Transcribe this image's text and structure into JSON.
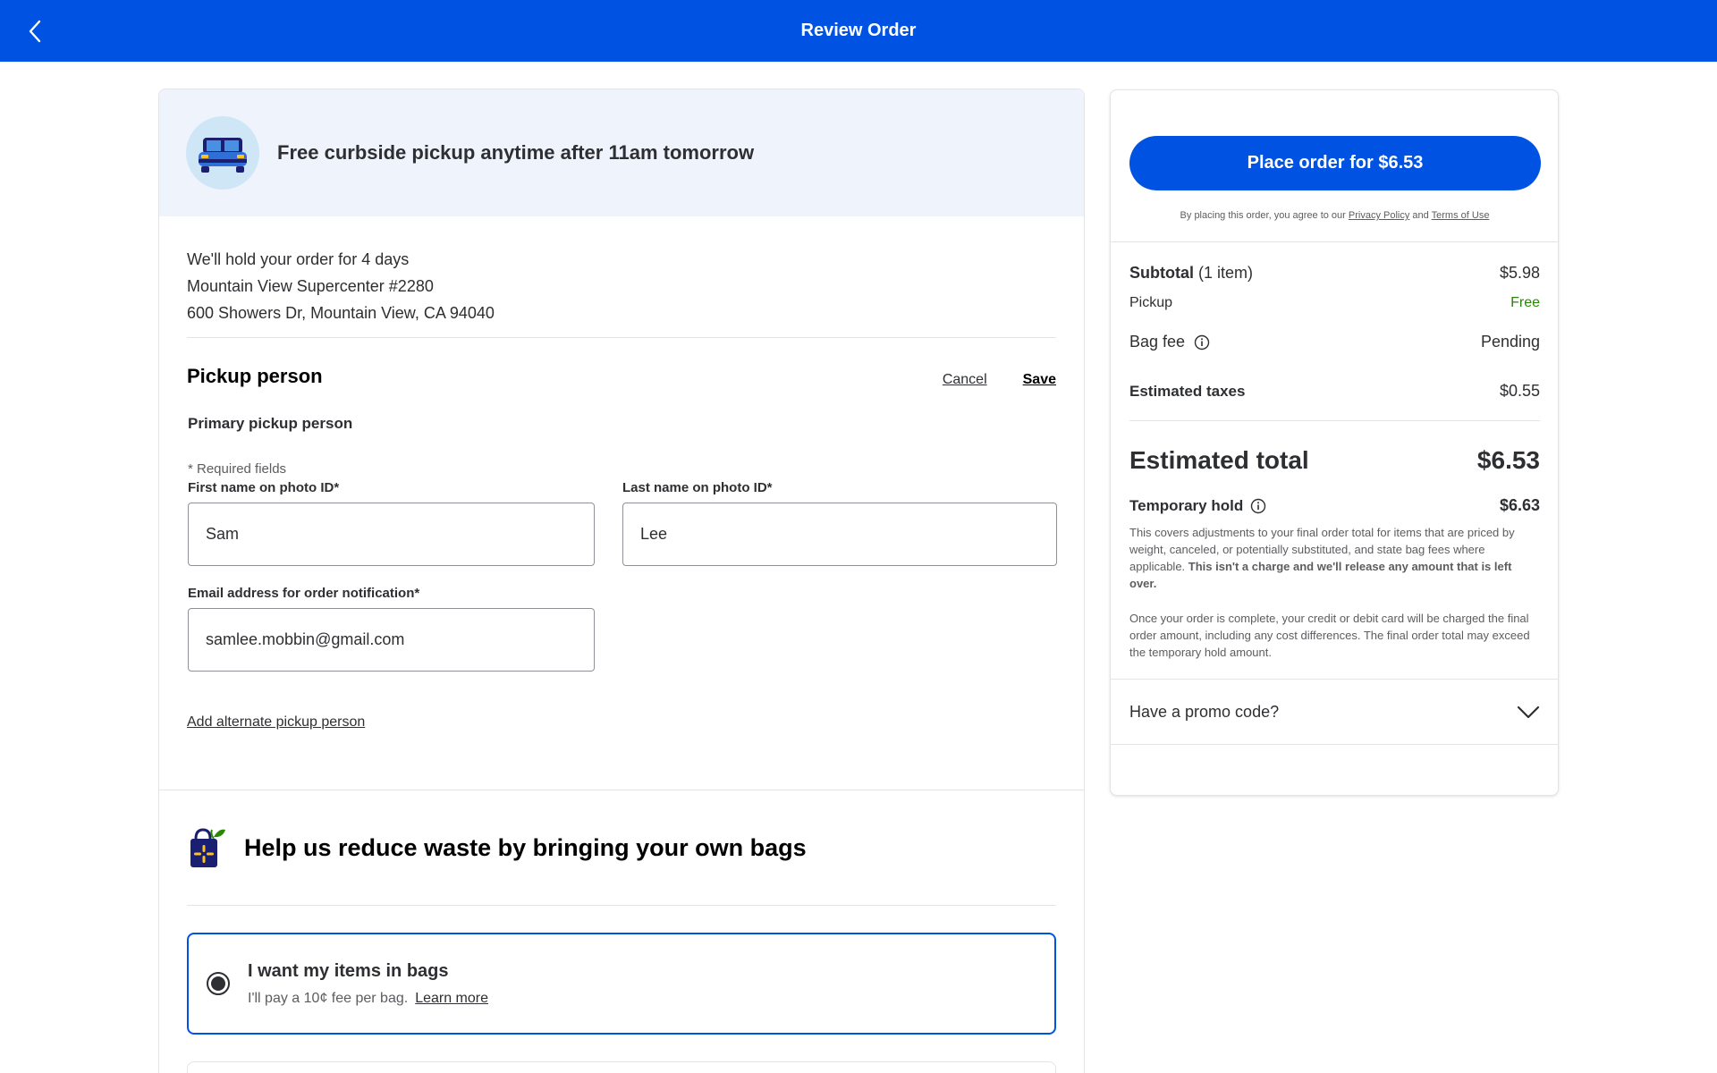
{
  "theme": {
    "brand": "#0053e2",
    "banner": "#eff4fc",
    "free_color": "#2a8703"
  },
  "header": {
    "title": "Review Order",
    "back_icon": "chevron-left-icon"
  },
  "pickup_banner": {
    "icon": "car-icon",
    "text": "Free curbside pickup anytime after 11am tomorrow"
  },
  "hold_info": {
    "line1": "We'll hold your order for 4 days",
    "line2": "Mountain View Supercenter #2280",
    "line3": "600 Showers Dr, Mountain View, CA 94040"
  },
  "pickup_person": {
    "title": "Pickup person",
    "cancel": "Cancel",
    "save": "Save",
    "subtitle": "Primary pickup person",
    "required_note": "* Required fields",
    "first_name_label": "First name on photo ID*",
    "first_name_value": "Sam",
    "last_name_label": "Last name on photo ID*",
    "last_name_value": "Lee",
    "email_label": "Email address for order notification*",
    "email_value": "samlee.mobbin@gmail.com",
    "add_alternate": "Add alternate pickup person"
  },
  "bags": {
    "icon": "reusable-bag-icon",
    "title": "Help us reduce waste by bringing your own bags",
    "option_title": "I want my items in bags",
    "option_sub": "I'll pay a 10¢ fee per bag.",
    "learn_more": "Learn more"
  },
  "order_summary": {
    "place_order": "Place order for $6.53",
    "agree_prefix": "By placing this order, you agree to our",
    "privacy": "Privacy Policy",
    "and": "and",
    "terms": "Terms of Use",
    "subtotal_label": "Subtotal",
    "subtotal_count": "(1 item)",
    "subtotal_value": "$5.98",
    "pickup_label": "Pickup",
    "pickup_value": "Free",
    "bag_fee_label": "Bag fee",
    "bag_fee_value": "Pending",
    "taxes_label": "Estimated taxes",
    "taxes_value": "$0.55",
    "total_label": "Estimated total",
    "total_value": "$6.53",
    "hold_label": "Temporary hold",
    "hold_value": "$6.63",
    "hold_note": "This covers adjustments to your final order total for items that are priced by weight, canceled, or potentially substituted, and state bag fees where applicable.",
    "hold_note_bold": "This isn't a charge and we'll release any amount that is left over.",
    "hold_note2": "Once your order is complete, your credit or debit card will be charged the final order amount, including any cost differences. The final order total may exceed the temporary hold amount.",
    "promo": "Have a promo code?"
  }
}
